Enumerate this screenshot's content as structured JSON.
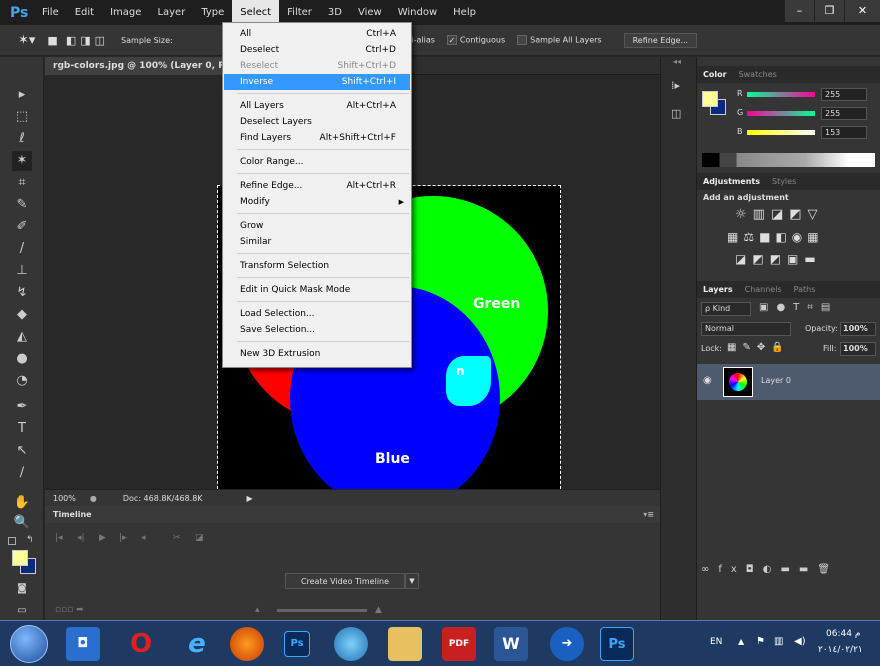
{
  "app": {
    "logo": "Ps"
  },
  "menubar": {
    "items": [
      "File",
      "Edit",
      "Image",
      "Layer",
      "Type",
      "Select",
      "Filter",
      "3D",
      "View",
      "Window",
      "Help"
    ],
    "active": "Select",
    "window_controls": [
      "–",
      "❐",
      "✕"
    ]
  },
  "options": {
    "sample_size_label": "Sample Size:",
    "anti_alias": "Anti-alias",
    "contiguous": "Contiguous",
    "sample_all_layers": "Sample All Layers",
    "refine_edge": "Refine Edge..."
  },
  "document": {
    "tab_title": "rgb-colors.jpg @ 100% (Layer 0, RGB/8",
    "labels": {
      "green": "Green",
      "blue": "Blue",
      "cyan_partial": "n"
    },
    "colors": {
      "red": "#ff0000",
      "green": "#00ff00",
      "blue": "#0000ff",
      "cyan": "#00ffff",
      "yellow": "#ffff00",
      "magenta": "#ff00ff",
      "white": "#ffffff"
    }
  },
  "status": {
    "zoom": "100%",
    "doc_size": "Doc: 468.8K/468.8K"
  },
  "timeline": {
    "title": "Timeline",
    "create_button": "Create Video Timeline"
  },
  "select_menu": {
    "items": [
      {
        "label": "All",
        "shortcut": "Ctrl+A",
        "state": "normal"
      },
      {
        "label": "Deselect",
        "shortcut": "Ctrl+D",
        "state": "normal"
      },
      {
        "label": "Reselect",
        "shortcut": "Shift+Ctrl+D",
        "state": "disabled"
      },
      {
        "label": "Inverse",
        "shortcut": "Shift+Ctrl+I",
        "state": "highlighted"
      },
      {
        "label": "All Layers",
        "shortcut": "Alt+Ctrl+A",
        "state": "normal"
      },
      {
        "label": "Deselect Layers",
        "shortcut": "",
        "state": "normal"
      },
      {
        "label": "Find Layers",
        "shortcut": "Alt+Shift+Ctrl+F",
        "state": "normal"
      },
      {
        "label": "Color Range...",
        "shortcut": "",
        "state": "normal"
      },
      {
        "label": "Refine Edge...",
        "shortcut": "Alt+Ctrl+R",
        "state": "normal"
      },
      {
        "label": "Modify",
        "shortcut": "",
        "state": "submenu"
      },
      {
        "label": "Grow",
        "shortcut": "",
        "state": "normal"
      },
      {
        "label": "Similar",
        "shortcut": "",
        "state": "normal"
      },
      {
        "label": "Transform Selection",
        "shortcut": "",
        "state": "normal"
      },
      {
        "label": "Edit in Quick Mask Mode",
        "shortcut": "",
        "state": "normal"
      },
      {
        "label": "Load Selection...",
        "shortcut": "",
        "state": "normal"
      },
      {
        "label": "Save Selection...",
        "shortcut": "",
        "state": "normal"
      },
      {
        "label": "New 3D Extrusion",
        "shortcut": "",
        "state": "normal"
      }
    ]
  },
  "color_panel": {
    "tabs": [
      "Color",
      "Swatches"
    ],
    "channels": [
      {
        "label": "R",
        "value": "255",
        "level": 1.0
      },
      {
        "label": "G",
        "value": "255",
        "level": 1.0
      },
      {
        "label": "B",
        "value": "153",
        "level": 0.6
      }
    ],
    "foreground": "#ffff99"
  },
  "adjustments_panel": {
    "tabs": [
      "Adjustments",
      "Styles"
    ],
    "subtitle": "Add an adjustment",
    "icons_row1": [
      "☼",
      "▥",
      "◪",
      "◩",
      "▽"
    ],
    "icons_row2": [
      "▦",
      "⚖",
      "■",
      "◧",
      "◉",
      "▦"
    ],
    "icons_row3": [
      "◪",
      "◩",
      "◩",
      "▣",
      "▬"
    ]
  },
  "layers_panel": {
    "tabs": [
      "Layers",
      "Channels",
      "Paths"
    ],
    "kind": "ρ Kind",
    "blend_mode": "Normal",
    "opacity_label": "Opacity:",
    "opacity_value": "100%",
    "lock_label": "Lock:",
    "fill_label": "Fill:",
    "fill_value": "100%",
    "layer_name": "Layer 0",
    "footer_icons": [
      "∞",
      "fx",
      "◘",
      "◐",
      "▬",
      "▬",
      "🗑"
    ]
  },
  "taskbar": {
    "lang": "EN",
    "time": "06:44 م",
    "date": "٢٠١٤/٠٢/٢١",
    "pdf_label": "PDF",
    "word_label": "W",
    "ps_label": "Ps"
  }
}
